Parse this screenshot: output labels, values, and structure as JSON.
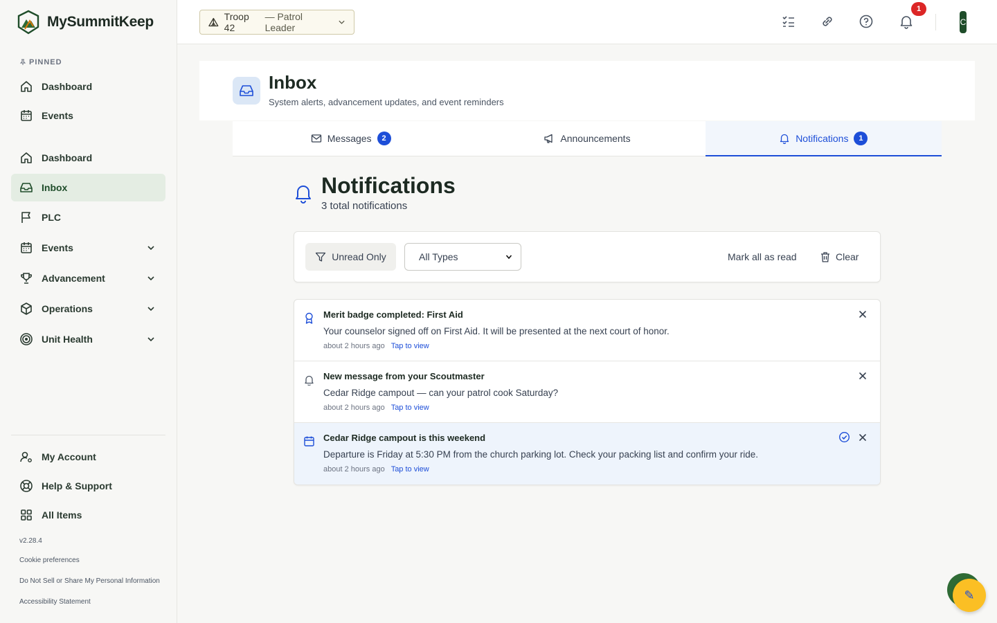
{
  "app": {
    "name": "MySummitKeep",
    "version": "v2.28.4"
  },
  "sidebar": {
    "pinned_label": "PINNED",
    "pinned": [
      {
        "label": "Dashboard",
        "icon": "home-icon"
      },
      {
        "label": "Events",
        "icon": "calendar-icon"
      }
    ],
    "items": [
      {
        "label": "Dashboard",
        "icon": "home-icon"
      },
      {
        "label": "Inbox",
        "icon": "inbox-icon",
        "active": true
      },
      {
        "label": "PLC",
        "icon": "flag-icon"
      },
      {
        "label": "Events",
        "icon": "calendar-icon",
        "expandable": true
      },
      {
        "label": "Advancement",
        "icon": "trophy-icon",
        "expandable": true
      },
      {
        "label": "Operations",
        "icon": "box-icon",
        "expandable": true
      },
      {
        "label": "Unit Health",
        "icon": "target-icon",
        "expandable": true
      }
    ],
    "bottom": [
      {
        "label": "My Account",
        "icon": "user-settings-icon"
      },
      {
        "label": "Help & Support",
        "icon": "lifebuoy-icon"
      },
      {
        "label": "All Items",
        "icon": "grid-icon"
      }
    ],
    "links": [
      "Cookie preferences",
      "Do Not Sell or Share My Personal Information",
      "Accessibility Statement"
    ]
  },
  "topbar": {
    "troop_name": "Troop 42",
    "troop_role": "— Patrol Leader",
    "notification_count": "1",
    "avatar_initial": "C"
  },
  "header": {
    "title": "Inbox",
    "subtitle": "System alerts, advancement updates, and event reminders"
  },
  "tabs": [
    {
      "label": "Messages",
      "badge": "2",
      "icon": "mail-icon"
    },
    {
      "label": "Announcements",
      "badge": "",
      "icon": "megaphone-icon"
    },
    {
      "label": "Notifications",
      "badge": "1",
      "icon": "bell-icon",
      "active": true
    }
  ],
  "notifications": {
    "title": "Notifications",
    "count_text": "3 total notifications",
    "filters": {
      "unread_label": "Unread Only",
      "type_selected": "All Types",
      "mark_all_label": "Mark all as read",
      "clear_label": "Clear"
    },
    "items": [
      {
        "icon": "award-icon",
        "title": "Merit badge completed: First Aid",
        "body": "Your counselor signed off on First Aid. It will be presented at the next court of honor.",
        "time": "about 2 hours ago",
        "link": "Tap to view",
        "unread": false
      },
      {
        "icon": "bell-icon",
        "title": "New message from your Scoutmaster",
        "body": "Cedar Ridge campout — can your patrol cook Saturday?",
        "time": "about 2 hours ago",
        "link": "Tap to view",
        "unread": false
      },
      {
        "icon": "calendar-icon",
        "title": "Cedar Ridge campout is this weekend",
        "body": "Departure is Friday at 5:30 PM from the church parking lot. Check your packing list and confirm your ride.",
        "time": "about 2 hours ago",
        "link": "Tap to view",
        "unread": true
      }
    ]
  },
  "colors": {
    "brand_green": "#1f4d2a",
    "accent_blue": "#1d4ed8",
    "alert_red": "#dc2626",
    "fab_yellow": "#fbbf24"
  }
}
